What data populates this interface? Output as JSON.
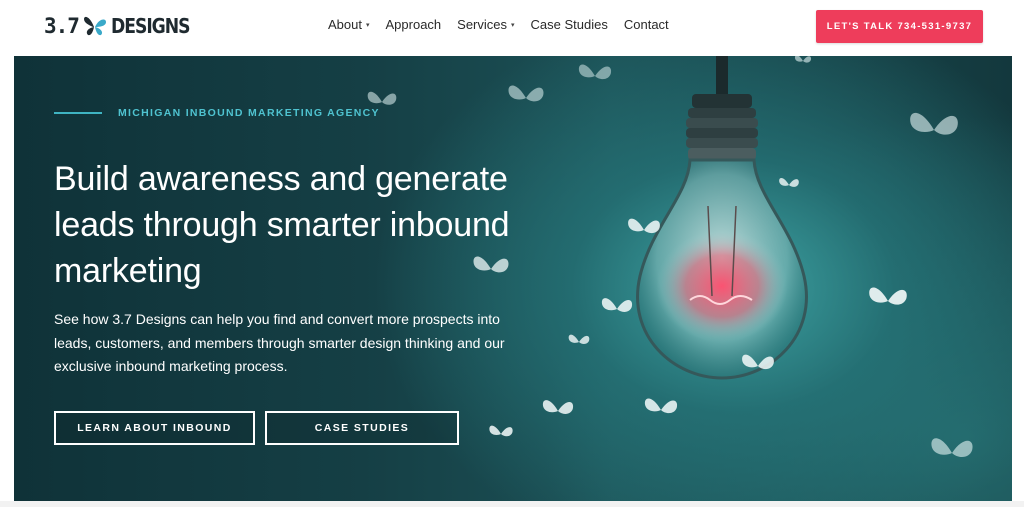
{
  "header": {
    "logo_number": "3.7",
    "logo_word": "DESIGNS",
    "logo_icon": "butterfly-icon",
    "nav": [
      {
        "label": "About",
        "has_dropdown": true
      },
      {
        "label": "Approach",
        "has_dropdown": false
      },
      {
        "label": "Services",
        "has_dropdown": true
      },
      {
        "label": "Case Studies",
        "has_dropdown": false
      },
      {
        "label": "Contact",
        "has_dropdown": false
      }
    ],
    "dropdown_caret": "▾",
    "cta_label": "LET'S TALK 734-531-9737"
  },
  "hero": {
    "eyebrow": "MICHIGAN INBOUND MARKETING AGENCY",
    "headline": "Build awareness and generate leads through smarter inbound marketing",
    "body": "See how 3.7 Designs can help you find and convert more prospects into leads, customers, and members through smarter design thinking and our exclusive inbound marketing process.",
    "primary_button": "LEARN ABOUT INBOUND",
    "secondary_button": "CASE STUDIES"
  },
  "colors": {
    "accent": "#ee3d5b",
    "eyebrow": "#4fc3d0",
    "hero_dark": "#0f3238",
    "hero_teal": "#40a8a8"
  }
}
